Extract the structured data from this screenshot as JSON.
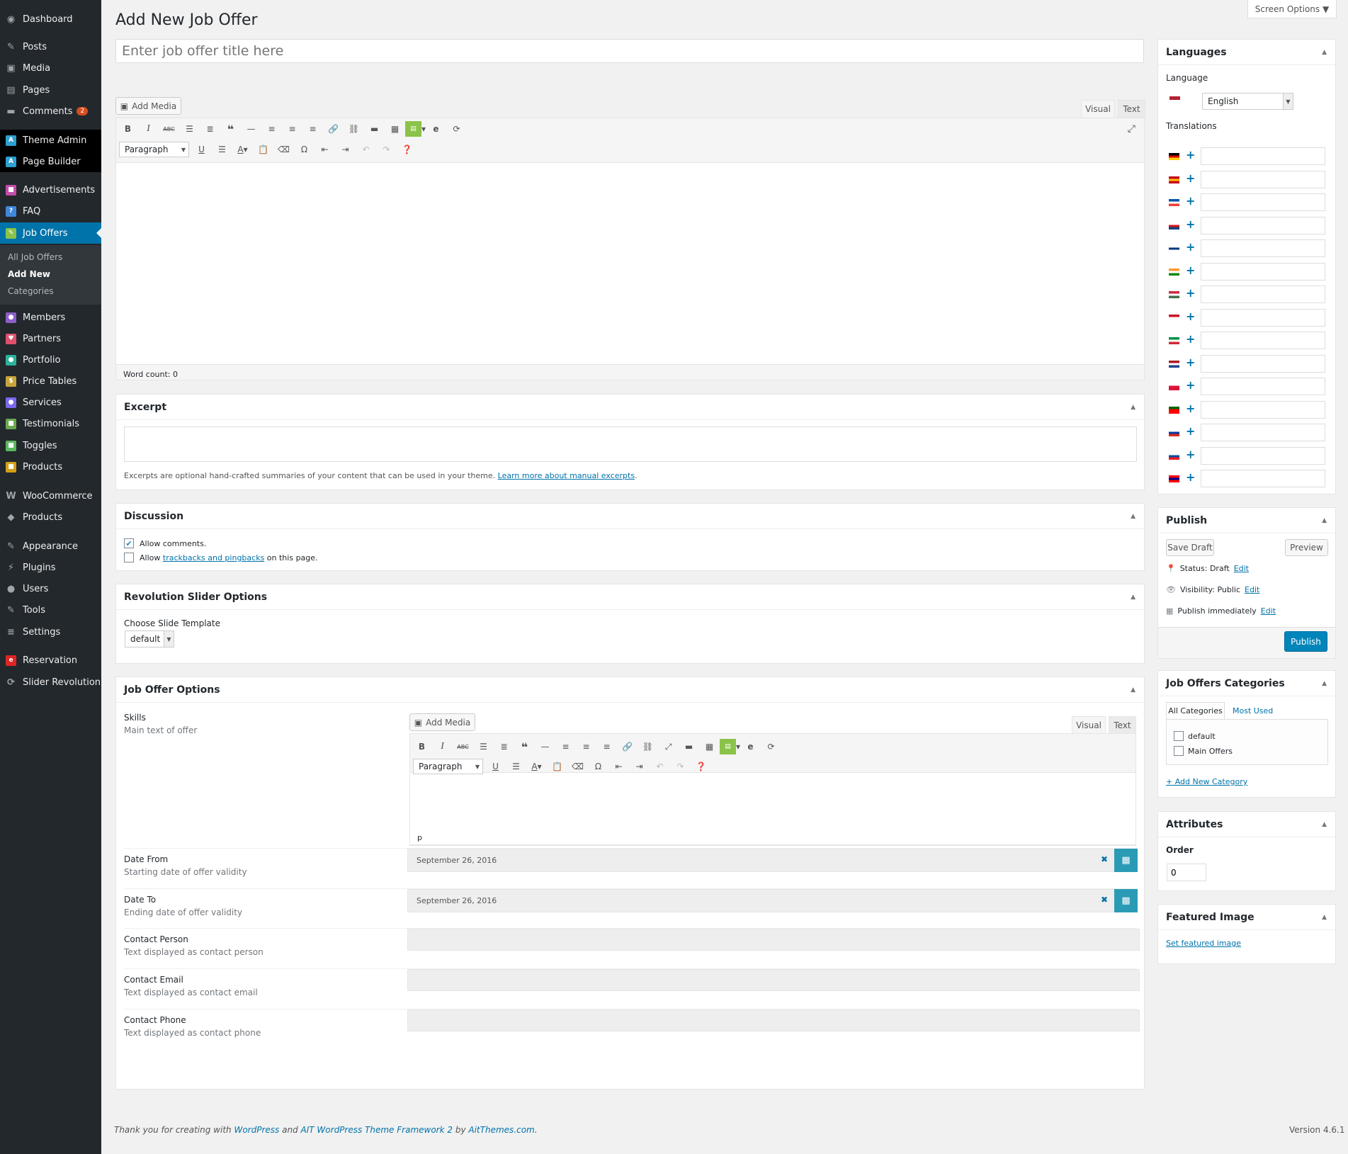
{
  "sidebar": {
    "items": [
      {
        "label": "Dashboard",
        "icon": "dashboard-icon",
        "name": "sidebar-item-dashboard"
      },
      {
        "label": "Posts",
        "icon": "pin-icon",
        "name": "sidebar-item-posts"
      },
      {
        "label": "Media",
        "icon": "media-icon",
        "name": "sidebar-item-media"
      },
      {
        "label": "Pages",
        "icon": "pages-icon",
        "name": "sidebar-item-pages"
      },
      {
        "label": "Comments",
        "icon": "comment-icon",
        "name": "sidebar-item-comments",
        "badge": "2"
      },
      {
        "label": "Theme Admin",
        "icon": "theme-icon",
        "name": "sidebar-item-theme-admin"
      },
      {
        "label": "Page Builder",
        "icon": "builder-icon",
        "name": "sidebar-item-page-builder"
      },
      {
        "label": "Advertisements",
        "icon": "ads-icon",
        "name": "sidebar-item-advertisements"
      },
      {
        "label": "FAQ",
        "icon": "faq-icon",
        "name": "sidebar-item-faq"
      },
      {
        "label": "Job Offers",
        "icon": "job-offers-icon",
        "name": "sidebar-item-job-offers"
      },
      {
        "label": "Members",
        "icon": "members-icon",
        "name": "sidebar-item-members"
      },
      {
        "label": "Partners",
        "icon": "partners-icon",
        "name": "sidebar-item-partners"
      },
      {
        "label": "Portfolio",
        "icon": "portfolio-icon",
        "name": "sidebar-item-portfolio"
      },
      {
        "label": "Price Tables",
        "icon": "price-icon",
        "name": "sidebar-item-price-tables"
      },
      {
        "label": "Services",
        "icon": "services-icon",
        "name": "sidebar-item-services"
      },
      {
        "label": "Testimonials",
        "icon": "testimonials-icon",
        "name": "sidebar-item-testimonials"
      },
      {
        "label": "Toggles",
        "icon": "toggles-icon",
        "name": "sidebar-item-toggles"
      },
      {
        "label": "Products",
        "icon": "products-icon",
        "name": "sidebar-item-products"
      },
      {
        "label": "WooCommerce",
        "icon": "woocommerce-icon",
        "name": "sidebar-item-woocommerce"
      },
      {
        "label": "Products",
        "icon": "box-icon",
        "name": "sidebar-item-woo-products"
      },
      {
        "label": "Appearance",
        "icon": "brush-icon",
        "name": "sidebar-item-appearance"
      },
      {
        "label": "Plugins",
        "icon": "plugin-icon",
        "name": "sidebar-item-plugins"
      },
      {
        "label": "Users",
        "icon": "user-icon",
        "name": "sidebar-item-users"
      },
      {
        "label": "Tools",
        "icon": "wrench-icon",
        "name": "sidebar-item-tools"
      },
      {
        "label": "Settings",
        "icon": "settings-icon",
        "name": "sidebar-item-settings"
      },
      {
        "label": "Reservation",
        "icon": "reservation-icon",
        "name": "sidebar-item-reservation"
      },
      {
        "label": "Slider Revolution",
        "icon": "refresh-icon",
        "name": "sidebar-item-slider-revolution"
      }
    ],
    "submenu": [
      "All Job Offers",
      "Add New",
      "Categories"
    ]
  },
  "screen_options": "Screen Options ▼",
  "page_title": "Add New Job Offer",
  "title_placeholder": "Enter job offer title here",
  "editor": {
    "add_media": "Add Media",
    "tab_visual": "Visual",
    "tab_text": "Text",
    "format": "Paragraph",
    "word_count": "Word count: 0"
  },
  "excerpt": {
    "title": "Excerpt",
    "help": "Excerpts are optional hand-crafted summaries of your content that can be used in your theme.",
    "link": "Learn more about manual excerpts",
    "after": "."
  },
  "discussion": {
    "title": "Discussion",
    "allow_comments": "Allow comments.",
    "allow_prefix": "Allow",
    "allow_link": "trackbacks and pingbacks",
    "allow_suffix": "on this page."
  },
  "revslider": {
    "title": "Revolution Slider Options",
    "label": "Choose Slide Template",
    "value": "default"
  },
  "job_options": {
    "title": "Job Offer Options",
    "skills_label": "Skills",
    "skills_desc": "Main text of offer",
    "path": "p",
    "fields": [
      {
        "label": "Date From",
        "desc": "Starting date of offer validity",
        "value": "September 26, 2016"
      },
      {
        "label": "Date To",
        "desc": "Ending date of offer validity",
        "value": "September 26, 2016"
      },
      {
        "label": "Contact Person",
        "desc": "Text displayed as contact person",
        "value": ""
      },
      {
        "label": "Contact Email",
        "desc": "Text displayed as contact email",
        "value": ""
      },
      {
        "label": "Contact Phone",
        "desc": "Text displayed as contact phone",
        "value": ""
      }
    ]
  },
  "languages": {
    "title": "Languages",
    "language_label": "Language",
    "language_value": "English",
    "translations_label": "Translations",
    "flags": [
      {
        "name": "german",
        "c": [
          "#000",
          "#d00",
          "#fc0"
        ]
      },
      {
        "name": "spanish",
        "c": [
          "#c60b1e",
          "#ffc400",
          "#c60b1e"
        ]
      },
      {
        "name": "french",
        "c": [
          "#0055a4",
          "#fff",
          "#ef4135"
        ]
      },
      {
        "name": "czech",
        "c": [
          "#fff",
          "#d7141a",
          "#11457e"
        ]
      },
      {
        "name": "finnish",
        "c": [
          "#fff",
          "#003580",
          "#fff"
        ]
      },
      {
        "name": "hindi",
        "c": [
          "#f93",
          "#fff",
          "#128807"
        ]
      },
      {
        "name": "hungarian",
        "c": [
          "#cd2a3e",
          "#fff",
          "#436f4d"
        ]
      },
      {
        "name": "indonesian",
        "c": [
          "#ce1126",
          "#fff",
          "#fff"
        ]
      },
      {
        "name": "italian",
        "c": [
          "#009246",
          "#fff",
          "#ce2b37"
        ]
      },
      {
        "name": "dutch",
        "c": [
          "#ae1c28",
          "#fff",
          "#21468b"
        ]
      },
      {
        "name": "polish",
        "c": [
          "#fff",
          "#dc143c",
          "#dc143c"
        ]
      },
      {
        "name": "portuguese",
        "c": [
          "#060",
          "#f00",
          "#f00"
        ]
      },
      {
        "name": "russian",
        "c": [
          "#fff",
          "#0039a6",
          "#d52b1e"
        ]
      },
      {
        "name": "slovak",
        "c": [
          "#fff",
          "#0b4ea2",
          "#ee1c25"
        ]
      },
      {
        "name": "taiwanese",
        "c": [
          "#fe0000",
          "#000095",
          "#fe0000"
        ]
      }
    ]
  },
  "publish": {
    "title": "Publish",
    "save_draft": "Save Draft",
    "preview": "Preview",
    "status": "Status: Draft",
    "visibility": "Visibility: Public",
    "schedule": "Publish immediately",
    "edit": "Edit",
    "publish": "Publish"
  },
  "categories": {
    "title": "Job Offers Categories",
    "tab_all": "All Categories",
    "tab_used": "Most Used",
    "items": [
      "default",
      "Main Offers"
    ],
    "add": "+ Add New Category"
  },
  "attributes": {
    "title": "Attributes",
    "order_label": "Order",
    "order_value": "0"
  },
  "featured": {
    "title": "Featured Image",
    "link": "Set featured image"
  },
  "footer": {
    "thanks": "Thank you for creating with",
    "wp": "WordPress",
    "and": "and",
    "ait": "AIT WordPress Theme Framework 2",
    "by": "by",
    "site": "AitThemes.com",
    "dot": ".",
    "version": "Version 4.6.1"
  },
  "colors": {
    "accent": "#0073aa",
    "sidebar": "#23282d",
    "primary_button": "#0085ba",
    "datepicker": "#2b9bb5"
  }
}
